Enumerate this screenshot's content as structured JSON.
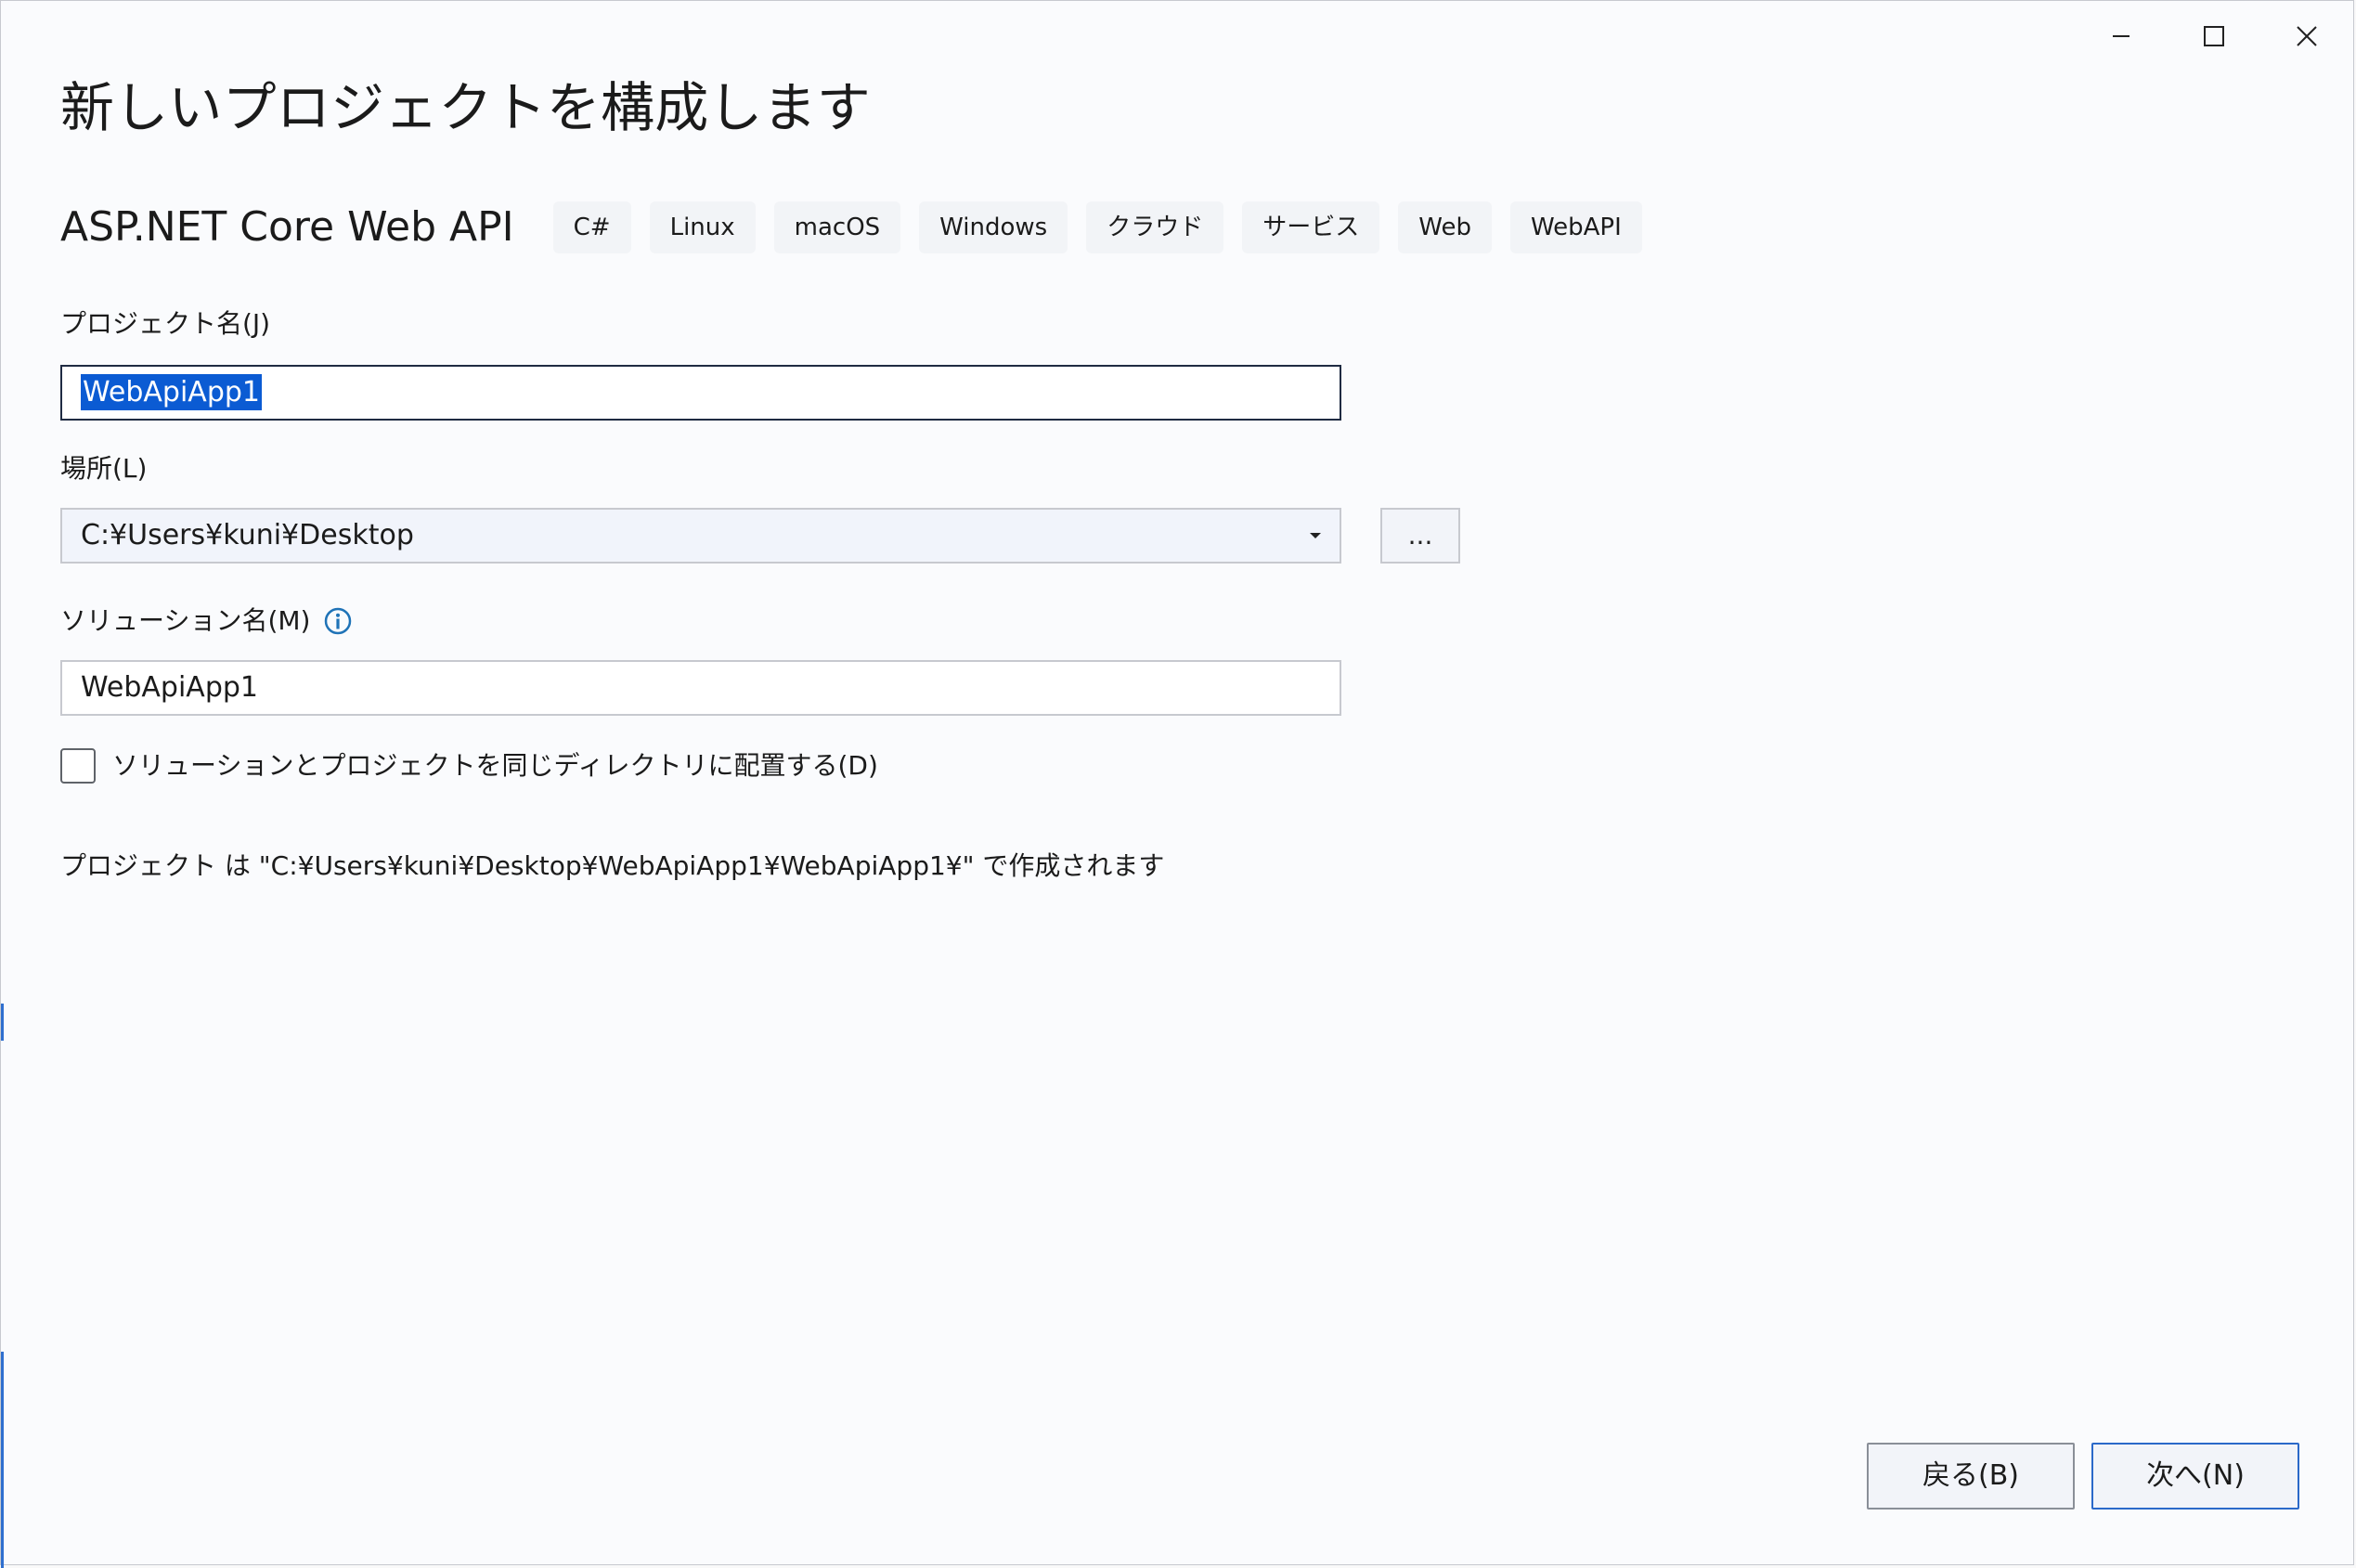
{
  "window": {
    "title": "新しいプロジェクトを構成します",
    "controls": {
      "minimize_icon": "minimize-icon",
      "maximize_icon": "maximize-icon",
      "close_icon": "close-icon"
    }
  },
  "template": {
    "name": "ASP.NET Core Web API",
    "tags": [
      "C#",
      "Linux",
      "macOS",
      "Windows",
      "クラウド",
      "サービス",
      "Web",
      "WebAPI"
    ]
  },
  "form": {
    "project_name": {
      "label": "プロジェクト名(J)",
      "value": "WebApiApp1",
      "selected": true
    },
    "location": {
      "label": "場所(L)",
      "value": "C:¥Users¥kuni¥Desktop",
      "browse_label": "..."
    },
    "solution_name": {
      "label": "ソリューション名(M)",
      "value": "WebApiApp1",
      "info_icon": "info-icon"
    },
    "same_directory": {
      "label": "ソリューションとプロジェクトを同じディレクトリに配置する(D)",
      "checked": false
    },
    "path_info": "プロジェクト は \"C:¥Users¥kuni¥Desktop¥WebApiApp1¥WebApiApp1¥\" で作成されます"
  },
  "footer": {
    "back_label": "戻る(B)",
    "next_label": "次へ(N)"
  },
  "colors": {
    "background": "#fafbfd",
    "selection": "#0b5bd3",
    "primary_border": "#2b69c9",
    "info_icon": "#1f73b7"
  }
}
